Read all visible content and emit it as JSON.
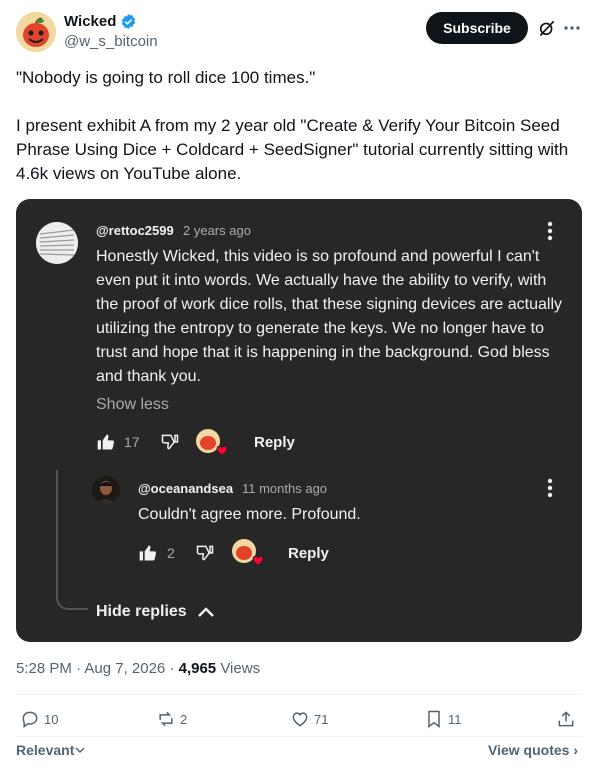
{
  "author": {
    "name": "Wicked",
    "handle": "@w_s_bitcoin"
  },
  "header": {
    "subscribe_label": "Subscribe"
  },
  "tweet": {
    "text": "\"Nobody is going to roll dice 100 times.\"\n\nI present exhibit A from my 2 year old \"Create & Verify Your Bitcoin Seed Phrase Using Dice + Coldcard + SeedSigner\" tutorial currently sitting with 4.6k views on YouTube alone."
  },
  "embed": {
    "comment1": {
      "user": "@rettoc2599",
      "time": "2 years ago",
      "body": "Honestly Wicked, this video is so profound and powerful I can't even put it into words.  We actually have the ability to verify, with the proof of work dice rolls, that these signing devices are actually utilizing the entropy to generate the keys.  We no longer have to trust and hope that it is happening in the background.  God bless and thank you.",
      "show_less": "Show less",
      "likes": "17",
      "reply_label": "Reply"
    },
    "comment2": {
      "user": "@oceanandsea",
      "time": "11 months ago",
      "body": "Couldn't agree more. Profound.",
      "likes": "2",
      "reply_label": "Reply"
    },
    "hide_replies": "Hide replies"
  },
  "meta": {
    "time": "5:28 PM · Aug 7, 2026 · ",
    "views_count": "4,965",
    "views_label": " Views"
  },
  "actions": {
    "replies": "10",
    "reposts": "2",
    "likes": "71",
    "bookmarks": "11"
  },
  "footer": {
    "sort_label": "Relevant",
    "view_quotes": "View quotes ›"
  },
  "colors": {
    "card_bg": "#272727",
    "text_secondary": "#536471",
    "verified_blue": "#1d9bf0"
  },
  "icons": [
    "verified-badge-icon",
    "grok-icon",
    "more-icon",
    "kebab-icon",
    "thumbs-up-icon",
    "thumbs-down-icon",
    "heart-avatar-icon",
    "chevron-up-icon",
    "reply-icon",
    "repost-icon",
    "like-icon",
    "bookmark-icon",
    "share-icon",
    "chevron-down-icon"
  ]
}
